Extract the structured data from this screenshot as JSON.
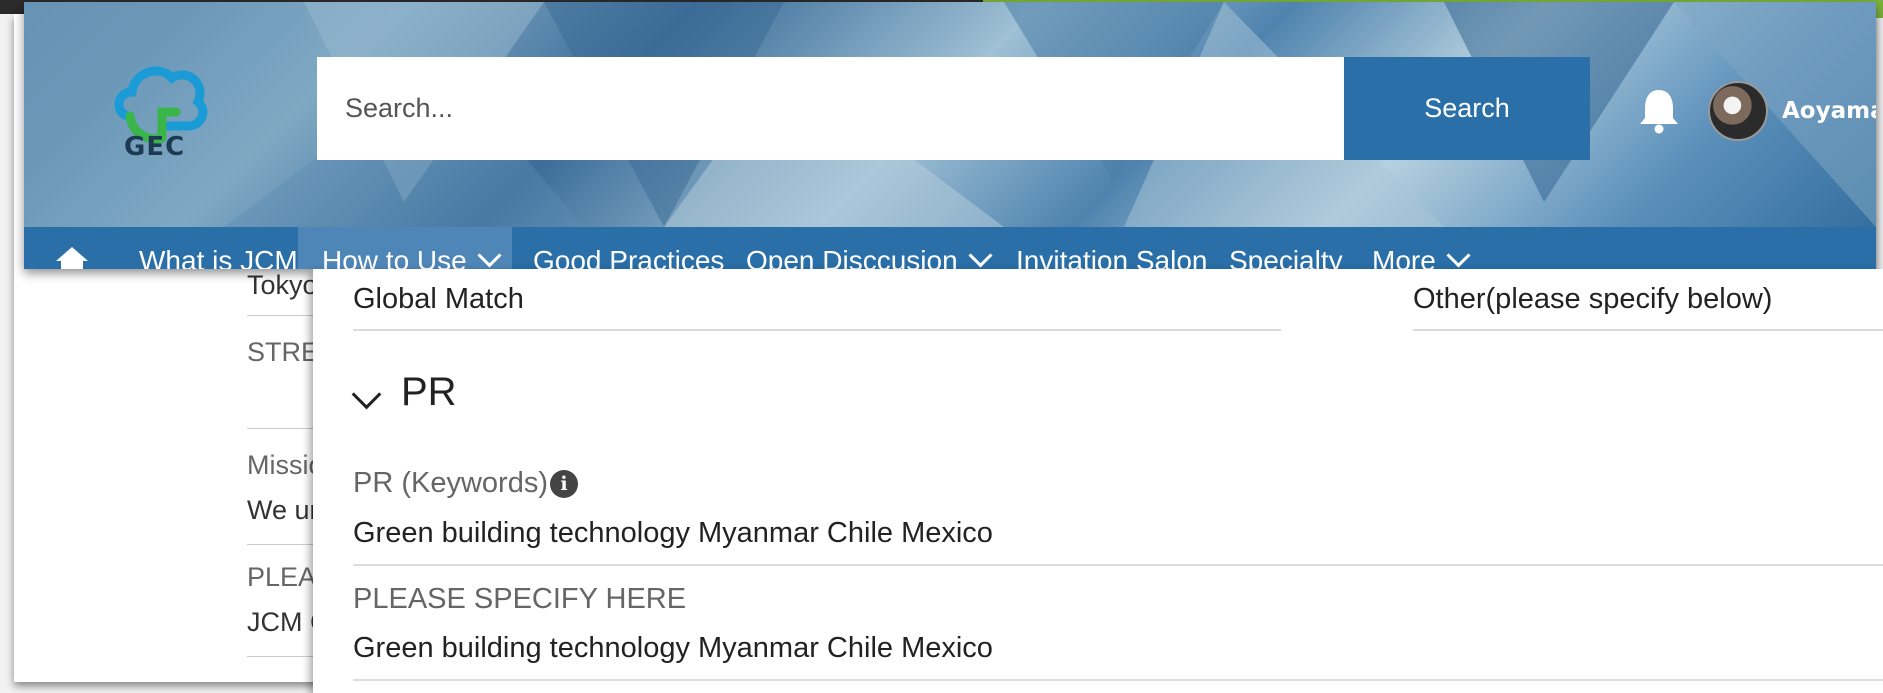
{
  "header": {
    "logo_text": "GEC",
    "search_placeholder": "Search...",
    "search_button": "Search",
    "user_name": "Aoyama"
  },
  "nav": {
    "items": [
      {
        "label": "What is JCM"
      },
      {
        "label": "How to Use",
        "has_dropdown": true
      },
      {
        "label": "Good Practices"
      },
      {
        "label": "Open Disccusion",
        "has_dropdown": true
      },
      {
        "label": "Invitation Salon"
      },
      {
        "label": "Specialty"
      },
      {
        "label": "More",
        "has_dropdown": true
      }
    ],
    "active_index": 1
  },
  "back_page": {
    "item_1": "Tokyo",
    "label_1": "STRE",
    "label_2": "Missio",
    "item_2": "We ur",
    "label_3": "PLEAS",
    "item_3": "JCM C"
  },
  "panel": {
    "row1_left": "Global Match",
    "row1_right": "Other(please specify below)",
    "section_title": "PR",
    "pr_keywords_label": "PR (Keywords)",
    "pr_keywords_value": "Green building technology Myanmar Chile Mexico",
    "specify_label": "PLEASE SPECIFY HERE",
    "specify_value": "Green building technology Myanmar Chile Mexico"
  },
  "colors": {
    "nav_bg": "#2a6fa8",
    "search_button_bg": "#2a6fa8",
    "accent_green": "#7cb23a"
  }
}
